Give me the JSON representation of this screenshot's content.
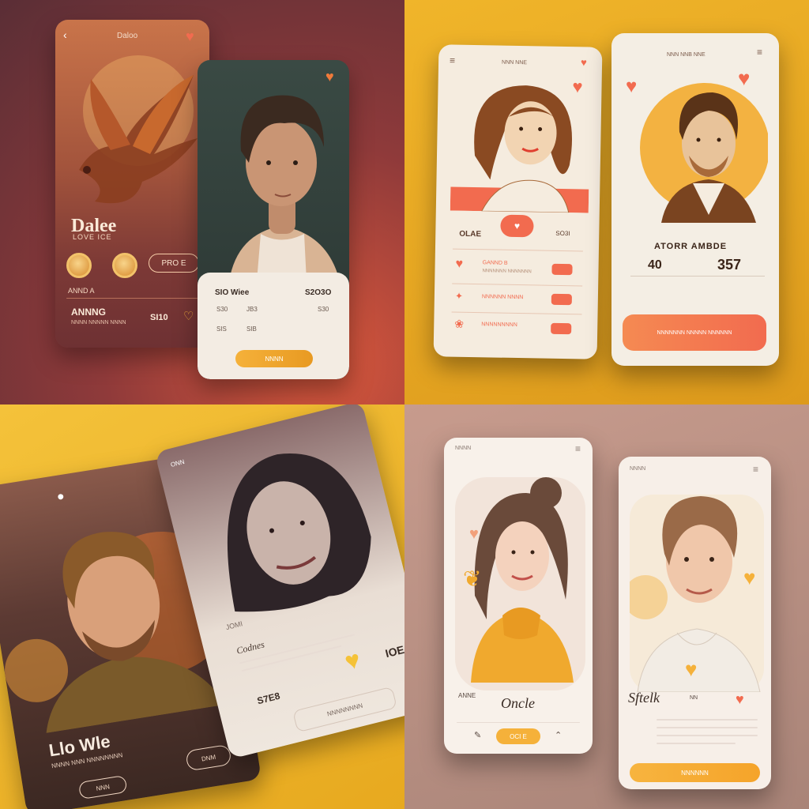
{
  "q1": {
    "card_a": {
      "name": "Dalee",
      "subtitle": "LOVE ICE",
      "button": "PRO E",
      "label1": "ANND A",
      "row_title": "ANNNG",
      "row_sub": "NNNN NNNNN NNNN",
      "row_value": "SI10"
    },
    "card_b": {
      "panel_title": "SIO Wiee",
      "panel_value1": "S2O3O",
      "panel_r2a": "S30",
      "panel_r2b": "JB3",
      "panel_r2c": "S30",
      "panel_r3a": "SIS",
      "panel_r3b": "SIB",
      "cta": "NNNN"
    }
  },
  "q2": {
    "card_a": {
      "header": "NNN NNE",
      "stat_label": "OLAE",
      "stat_value": "SO3I",
      "rows": [
        {
          "title": "GANND B",
          "sub": "NNNNNNN NNNNNNN"
        },
        {
          "title": "NNNNNN NNNN",
          "sub": ""
        },
        {
          "title": "NNNNNNNNN",
          "sub": ""
        }
      ]
    },
    "card_b": {
      "header": "NNN NNB NNE",
      "name": "ATORR AMBDE",
      "stat1": "40",
      "stat2": "357",
      "cta": "NNNNNNN NNNNN NNNNNN"
    }
  },
  "q3": {
    "card_a": {
      "name": "Llo Wle",
      "sub": "NNNN NNN NNNNNNNN",
      "button_a": "DNM",
      "button_b": "NNN"
    },
    "card_b": {
      "top": "ONN",
      "tag": "JOMI",
      "label": "Codnes",
      "value1": "IOE",
      "value2": "S7E8",
      "cta": "NNNNNNNN"
    }
  },
  "q4": {
    "card_a": {
      "label": "ANNE",
      "signature": "Oncle",
      "cta": "OCI E"
    },
    "card_b": {
      "signature": "Sftelk",
      "badge": "NN",
      "cta": "NNNNNN"
    }
  },
  "colors": {
    "coral": "#f26b4f",
    "amber": "#f5b13a",
    "cream": "#f5ecdf"
  }
}
